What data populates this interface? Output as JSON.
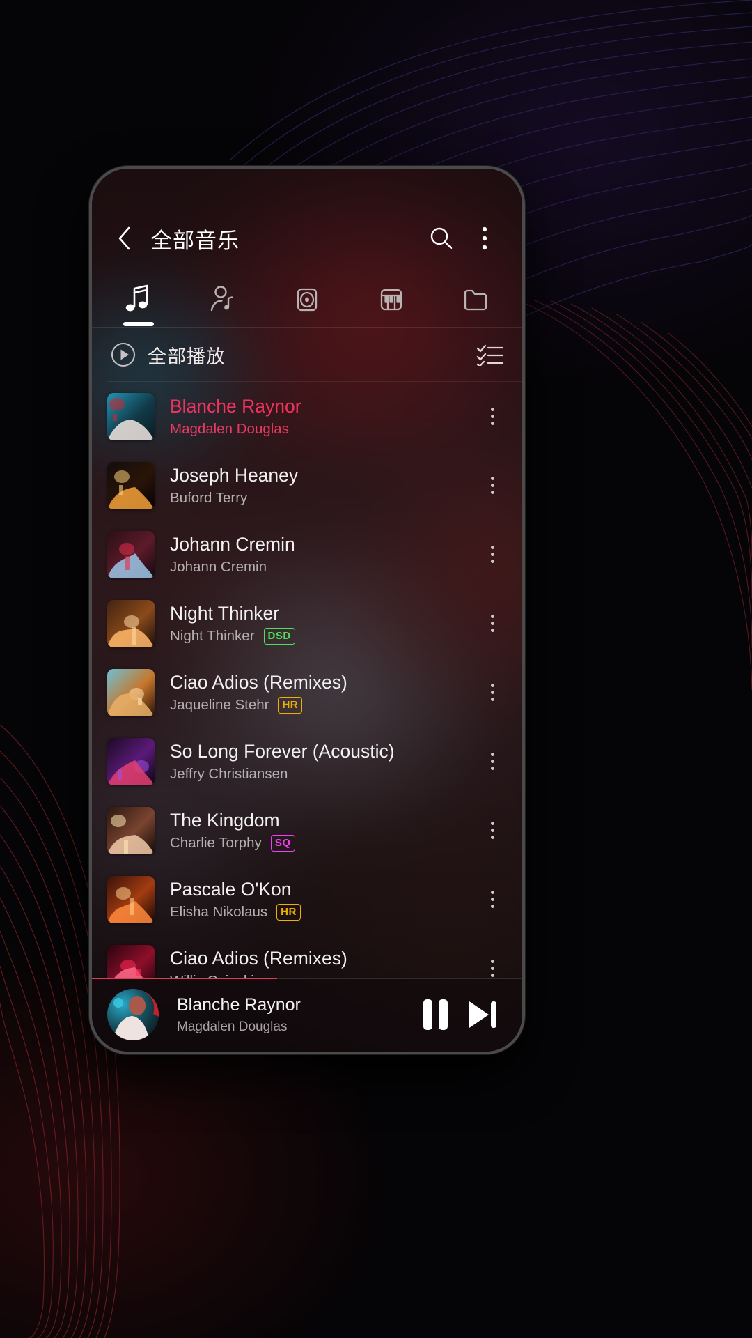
{
  "theme": {
    "accent": "#f2325e",
    "progress_color": "#e03a52",
    "badge_dsd_color": "#4ee05a",
    "badge_hr_color": "#f0b000",
    "badge_sq_color": "#f43df4",
    "text_primary": "#f2f0f0",
    "text_secondary": "#b6b0b2"
  },
  "topbar": {
    "back_icon": "chevron-left-icon",
    "title": "全部音乐",
    "search_icon": "search-icon",
    "overflow_icon": "more-vertical-icon"
  },
  "tabs": [
    {
      "name": "songs",
      "icon": "music-note-icon",
      "active": true
    },
    {
      "name": "artists",
      "icon": "artist-icon",
      "active": false
    },
    {
      "name": "albums",
      "icon": "album-disc-icon",
      "active": false
    },
    {
      "name": "genres",
      "icon": "piano-keys-icon",
      "active": false
    },
    {
      "name": "folders",
      "icon": "folder-icon",
      "active": false
    }
  ],
  "playall": {
    "play_icon": "play-circle-icon",
    "label": "全部播放",
    "select_icon": "checklist-icon"
  },
  "songs": [
    {
      "title": "Blanche Raynor",
      "artist": "Magdalen Douglas",
      "badge": "",
      "playing": true
    },
    {
      "title": "Joseph Heaney",
      "artist": "Buford Terry",
      "badge": "",
      "playing": false
    },
    {
      "title": "Johann Cremin",
      "artist": "Johann Cremin",
      "badge": "",
      "playing": false
    },
    {
      "title": "Night Thinker",
      "artist": "Night Thinker",
      "badge": "DSD",
      "playing": false
    },
    {
      "title": "Ciao Adios (Remixes)",
      "artist": "Jaqueline Stehr",
      "badge": "HR",
      "playing": false
    },
    {
      "title": "So Long Forever (Acoustic)",
      "artist": "Jeffry Christiansen",
      "badge": "",
      "playing": false
    },
    {
      "title": "The Kingdom",
      "artist": "Charlie Torphy",
      "badge": "SQ",
      "playing": false
    },
    {
      "title": "Pascale O'Kon",
      "artist": "Elisha Nikolaus",
      "badge": "HR",
      "playing": false
    },
    {
      "title": "Ciao Adios (Remixes)",
      "artist": "Willis Osinski",
      "badge": "",
      "playing": false
    }
  ],
  "row_more_icon": "more-vertical-icon",
  "player": {
    "art_icon": "album-avatar",
    "title": "Blanche Raynor",
    "artist": "Magdalen Douglas",
    "pause_icon": "pause-icon",
    "next_icon": "skip-next-icon",
    "progress_percent": 43
  }
}
